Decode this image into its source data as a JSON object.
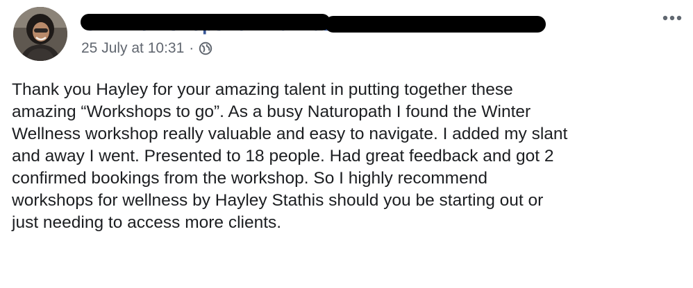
{
  "post": {
    "author_name": "C… Workshops for Wellness",
    "timestamp": "25 July at 10:31",
    "separator": "·",
    "audience_icon": "globe-icon",
    "more_icon": "more-options-icon",
    "body_lines": [
      "Thank you Hayley for your amazing talent in putting together these",
      "amazing “Workshops to go”. As a busy Naturopath I found the Winter",
      "Wellness workshop really valuable and easy to navigate. I added my slant",
      "and away I went. Presented to 18 people. Had great feedback and got 2",
      "confirmed bookings from the workshop. So I highly recommend",
      "workshops for wellness by Hayley Stathis should you be starting out or",
      "just needing to access more clients."
    ]
  },
  "colors": {
    "author_link": "#385898",
    "meta_text": "#616770",
    "body_text": "#1c1e21",
    "redaction": "#000000"
  }
}
